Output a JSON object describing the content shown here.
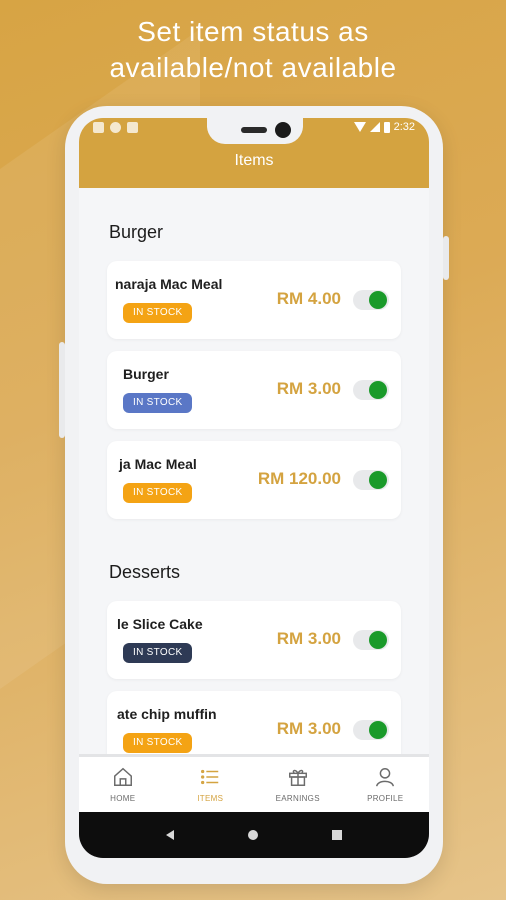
{
  "headline": {
    "line1": "Set item status as",
    "line2": "available/not available"
  },
  "status_bar": {
    "time": "2:32"
  },
  "header": {
    "title": "Items"
  },
  "sections": [
    {
      "title": "Burger",
      "items": [
        {
          "name": "naraja Mac Meal",
          "badge": "IN STOCK",
          "badge_color": "#f4a314",
          "price": "RM 4.00",
          "available": true
        },
        {
          "name": "Burger",
          "badge": "IN STOCK",
          "badge_color": "#5a77c6",
          "price": "RM 3.00",
          "available": true
        },
        {
          "name": "ja Mac Meal",
          "badge": "IN STOCK",
          "badge_color": "#f4a314",
          "price": "RM 120.00",
          "available": true
        }
      ]
    },
    {
      "title": "Desserts",
      "items": [
        {
          "name": "le Slice Cake",
          "badge": "IN STOCK",
          "badge_color": "#2e3a55",
          "price": "RM 3.00",
          "available": true
        },
        {
          "name": "ate chip muffin",
          "badge": "IN STOCK",
          "badge_color": "#f4a314",
          "price": "RM 3.00",
          "available": true
        }
      ]
    }
  ],
  "bottom_nav": [
    {
      "label": "HOME",
      "icon": "home-icon",
      "active": false
    },
    {
      "label": "ITEMS",
      "icon": "list-icon",
      "active": true
    },
    {
      "label": "EARNINGS",
      "icon": "gift-icon",
      "active": false
    },
    {
      "label": "PROFILE",
      "icon": "user-icon",
      "active": false
    }
  ],
  "colors": {
    "accent": "#d4a340",
    "toggle_on": "#1a9a2a"
  }
}
